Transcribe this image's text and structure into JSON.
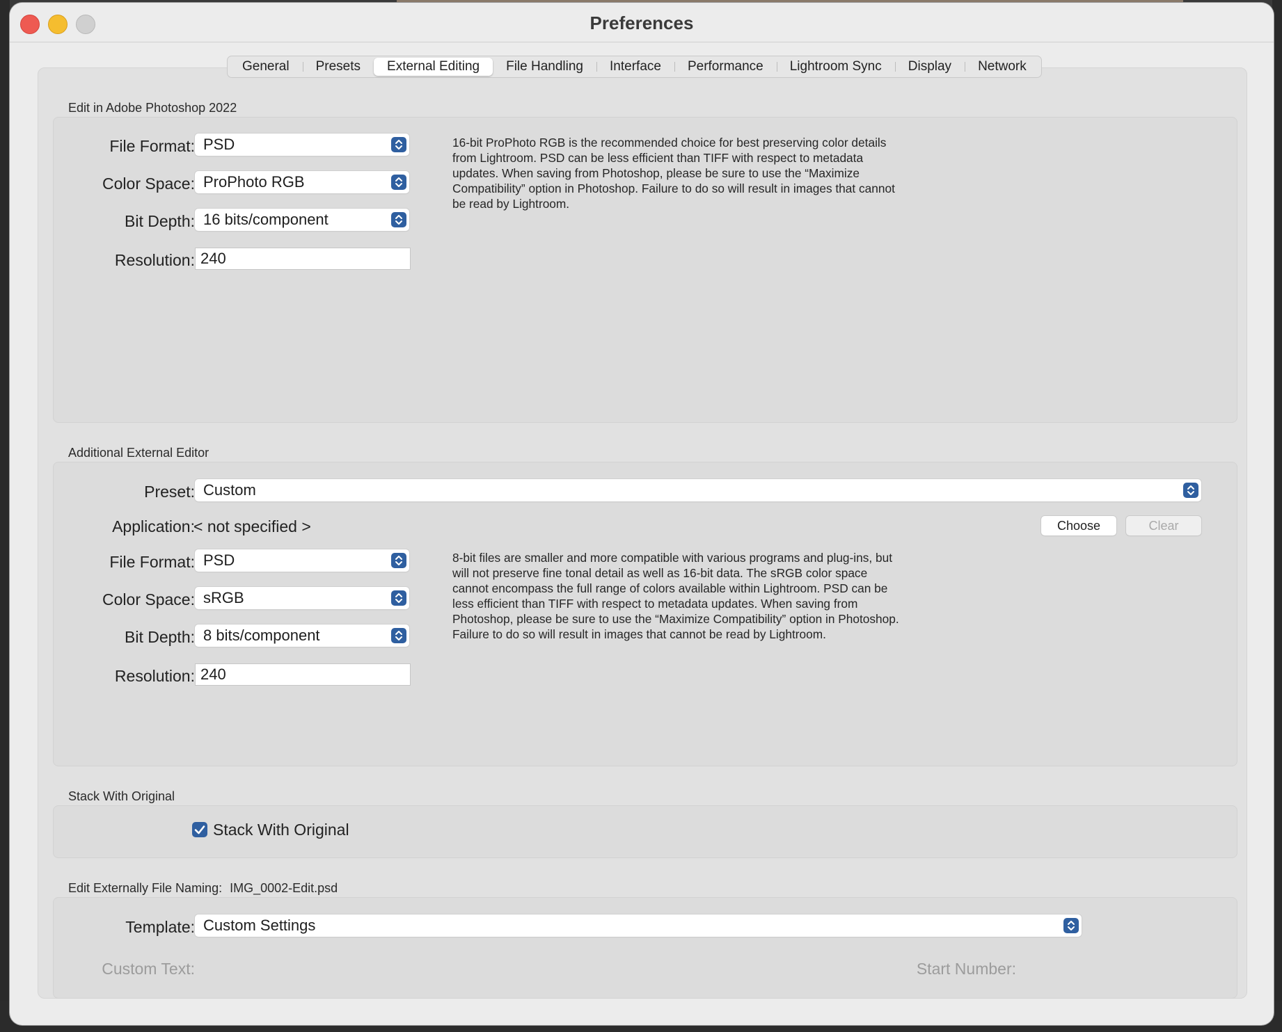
{
  "window": {
    "title": "Preferences"
  },
  "tabs": [
    {
      "label": "General",
      "active": false
    },
    {
      "label": "Presets",
      "active": false
    },
    {
      "label": "External Editing",
      "active": true
    },
    {
      "label": "File Handling",
      "active": false
    },
    {
      "label": "Interface",
      "active": false
    },
    {
      "label": "Performance",
      "active": false
    },
    {
      "label": "Lightroom Sync",
      "active": false
    },
    {
      "label": "Display",
      "active": false
    },
    {
      "label": "Network",
      "active": false
    }
  ],
  "photoshop": {
    "section_title": "Edit in Adobe Photoshop 2022",
    "file_format_label": "File Format:",
    "file_format_value": "PSD",
    "color_space_label": "Color Space:",
    "color_space_value": "ProPhoto RGB",
    "bit_depth_label": "Bit Depth:",
    "bit_depth_value": "16 bits/component",
    "resolution_label": "Resolution:",
    "resolution_value": "240",
    "description": "16-bit ProPhoto RGB is the recommended choice for best preserving color details from Lightroom. PSD can be less efficient than TIFF with respect to metadata updates. When saving from Photoshop, please be sure to use the “Maximize Compatibility” option in Photoshop. Failure to do so will result in images that cannot be read by Lightroom."
  },
  "additional_editor": {
    "section_title": "Additional External Editor",
    "preset_label": "Preset:",
    "preset_value": "Custom",
    "application_label": "Application:",
    "application_value": "< not specified >",
    "choose_label": "Choose",
    "clear_label": "Clear",
    "file_format_label": "File Format:",
    "file_format_value": "PSD",
    "color_space_label": "Color Space:",
    "color_space_value": "sRGB",
    "bit_depth_label": "Bit Depth:",
    "bit_depth_value": "8 bits/component",
    "resolution_label": "Resolution:",
    "resolution_value": "240",
    "description": "8-bit files are smaller and more compatible with various programs and plug-ins, but will not preserve fine tonal detail as well as 16-bit data. The sRGB color space cannot encompass the full range of colors available within Lightroom. PSD can be less efficient than TIFF with respect to metadata updates. When saving from Photoshop, please be sure to use the “Maximize Compatibility” option in Photoshop. Failure to do so will result in images that cannot be read by Lightroom."
  },
  "stack": {
    "section_title": "Stack With Original",
    "checkbox_label": "Stack With Original",
    "checked": true
  },
  "naming": {
    "section_title": "Edit Externally File Naming:",
    "example_filename": "IMG_0002-Edit.psd",
    "template_label": "Template:",
    "template_value": "Custom Settings",
    "custom_text_label": "Custom Text:",
    "start_number_label": "Start Number:"
  },
  "colors": {
    "accent": "#2f5fa0",
    "close": "#ee5a52",
    "minimize": "#f5bd2f",
    "zoom_inactive": "#d0d0d0"
  },
  "icons": {
    "popup_stepper": "up-down-chevron-icon",
    "checkbox": "checkmark-icon"
  }
}
